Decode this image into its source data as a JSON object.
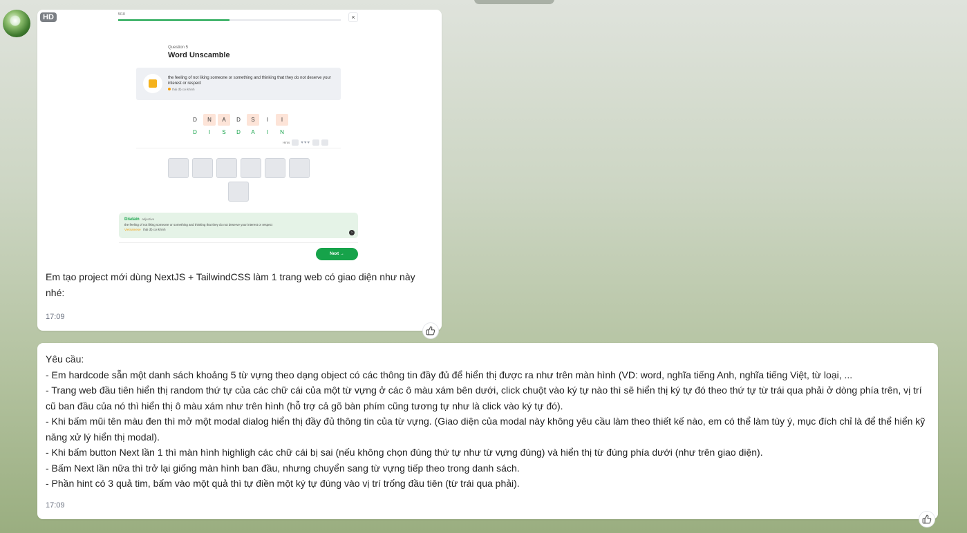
{
  "top_pill": "",
  "message1": {
    "hd_badge": "HD",
    "screenshot": {
      "progress_label": "5/10",
      "progress_fraction": 0.5,
      "close_label": "×",
      "question_label": "Question 5",
      "question_title": "Word Unscamble",
      "definition_en": "the feeling of not liking someone or something and thinking that they do not deserve your interest or respect",
      "definition_vi": "thái độ coi khinh",
      "scrambled_letters": [
        "D",
        "N",
        "A",
        "D",
        "S",
        "I",
        "I"
      ],
      "highlighted_indices": [
        1,
        2,
        4,
        6
      ],
      "answer_letters": [
        "D",
        "I",
        "S",
        "D",
        "A",
        "I",
        "N"
      ],
      "hints_label": "Hints",
      "hearts": "♥♥♥",
      "answer_card": {
        "word": "Disdain",
        "pos": "adjective",
        "definition": "the feeling of not liking someone or something and thinking that they do not deserve your interest or respect",
        "vi_tag": "Vietnamese",
        "vi": "thái độ coi khinh",
        "arrow": "›"
      },
      "next_label": "Next →"
    },
    "text": "Em tạo project mới dùng NextJS + TailwindCSS làm 1 trang web có giao diện như này nhé:",
    "time": "17:09"
  },
  "message2": {
    "lines": [
      "Yêu cầu:",
      "- Em hardcode sẵn một danh sách khoảng 5 từ vựng theo dạng object có các thông tin đầy đủ để hiển thị được ra như trên màn hình (VD: word, nghĩa tiếng Anh, nghĩa tiếng Việt, từ loại, ...",
      "- Trang web đầu tiên hiển thị random thứ tự của các chữ cái của một từ vựng ở các ô màu xám bên dưới, click chuột vào ký tự nào thì sẽ hiển thị ký tự đó theo thứ tự từ trái qua phải ở dòng phía trên, vị trí cũ ban đầu của nó thì hiển thị ô màu xám như trên hình (hỗ trợ cả gõ bàn phím cũng tương tự như là click vào ký tự đó).",
      "- Khi bấm mũi tên màu đen thì mở một modal dialog hiển thị đầy đủ thông tin của từ vựng. (Giao diện của modal này không yêu cầu làm theo thiết kế nào, em có thể làm tùy ý, mục đích chỉ là để thể hiển kỹ năng xử lý hiển thị modal).",
      "- Khi bấm button Next lần 1 thì màn hình highligh các chữ cái bị sai (nếu không chọn đúng thứ tự như từ vựng đúng) và hiển thị từ đúng phía dưới (như trên giao diện).",
      "- Bấm Next lần nữa thì trở lại giống màn hình ban đầu, nhưng chuyển sang từ vựng tiếp theo trong danh sách.",
      "- Phần hint có 3 quả tim, bấm vào một quả thì tự điền một ký tự đúng vào vị trí trống đầu tiên (từ trái qua phải)."
    ],
    "time": "17:09"
  },
  "colors": {
    "accent_green": "#16a34a",
    "highlight": "#fde4d8",
    "slot_gray": "#e5e7eb"
  },
  "icons": {
    "avatar": "avatar-image",
    "react": "thumbs-up-icon"
  }
}
